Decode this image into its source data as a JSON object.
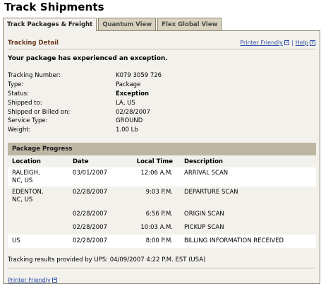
{
  "page_title": "Track Shipments",
  "tabs": [
    {
      "label": "Track Packages & Freight",
      "active": true
    },
    {
      "label": "Quantum View",
      "active": false
    },
    {
      "label": "Flex Global View",
      "active": false
    }
  ],
  "detail": {
    "title": "Tracking Detail",
    "printer_friendly": "Printer Friendly",
    "separator": "|",
    "help": "Help",
    "exception_message": "Your package has experienced an exception."
  },
  "info": [
    {
      "label": "Tracking Number:",
      "value": "K079 3059 726"
    },
    {
      "label": "Type:",
      "value": "Package"
    },
    {
      "label": "Status:",
      "value": "Exception"
    },
    {
      "label": "Shipped to:",
      "value": "LA, US"
    },
    {
      "label": "Shipped or Billed on:",
      "value": "02/28/2007"
    },
    {
      "label": "Service Type:",
      "value": "GROUND"
    },
    {
      "label": "Weight:",
      "value": "1.00 Lb"
    }
  ],
  "progress": {
    "title": "Package Progress",
    "columns": [
      "Location",
      "Date",
      "Local Time",
      "Description"
    ],
    "rows": [
      {
        "location": "RALEIGH,\nNC,  US",
        "date": "03/01/2007",
        "time": "12:06 A.M.",
        "description": "ARRIVAL SCAN"
      },
      {
        "location": "EDENTON,\nNC,  US",
        "date": "02/28/2007",
        "time": "9:03 P.M.",
        "description": "DEPARTURE SCAN"
      },
      {
        "location": "",
        "date": "02/28/2007",
        "time": "6:56 P.M.",
        "description": "ORIGIN SCAN"
      },
      {
        "location": "",
        "date": "02/28/2007",
        "time": "10:03 A.M.",
        "description": "PICKUP SCAN"
      },
      {
        "location": "US",
        "date": "02/28/2007",
        "time": "8:00 P.M.",
        "description": "BILLING INFORMATION RECEIVED"
      }
    ]
  },
  "results_text": "Tracking results provided by UPS:  04/09/2007 4:22 P.M.  EST (USA)",
  "bottom_link": "Printer Friendly"
}
